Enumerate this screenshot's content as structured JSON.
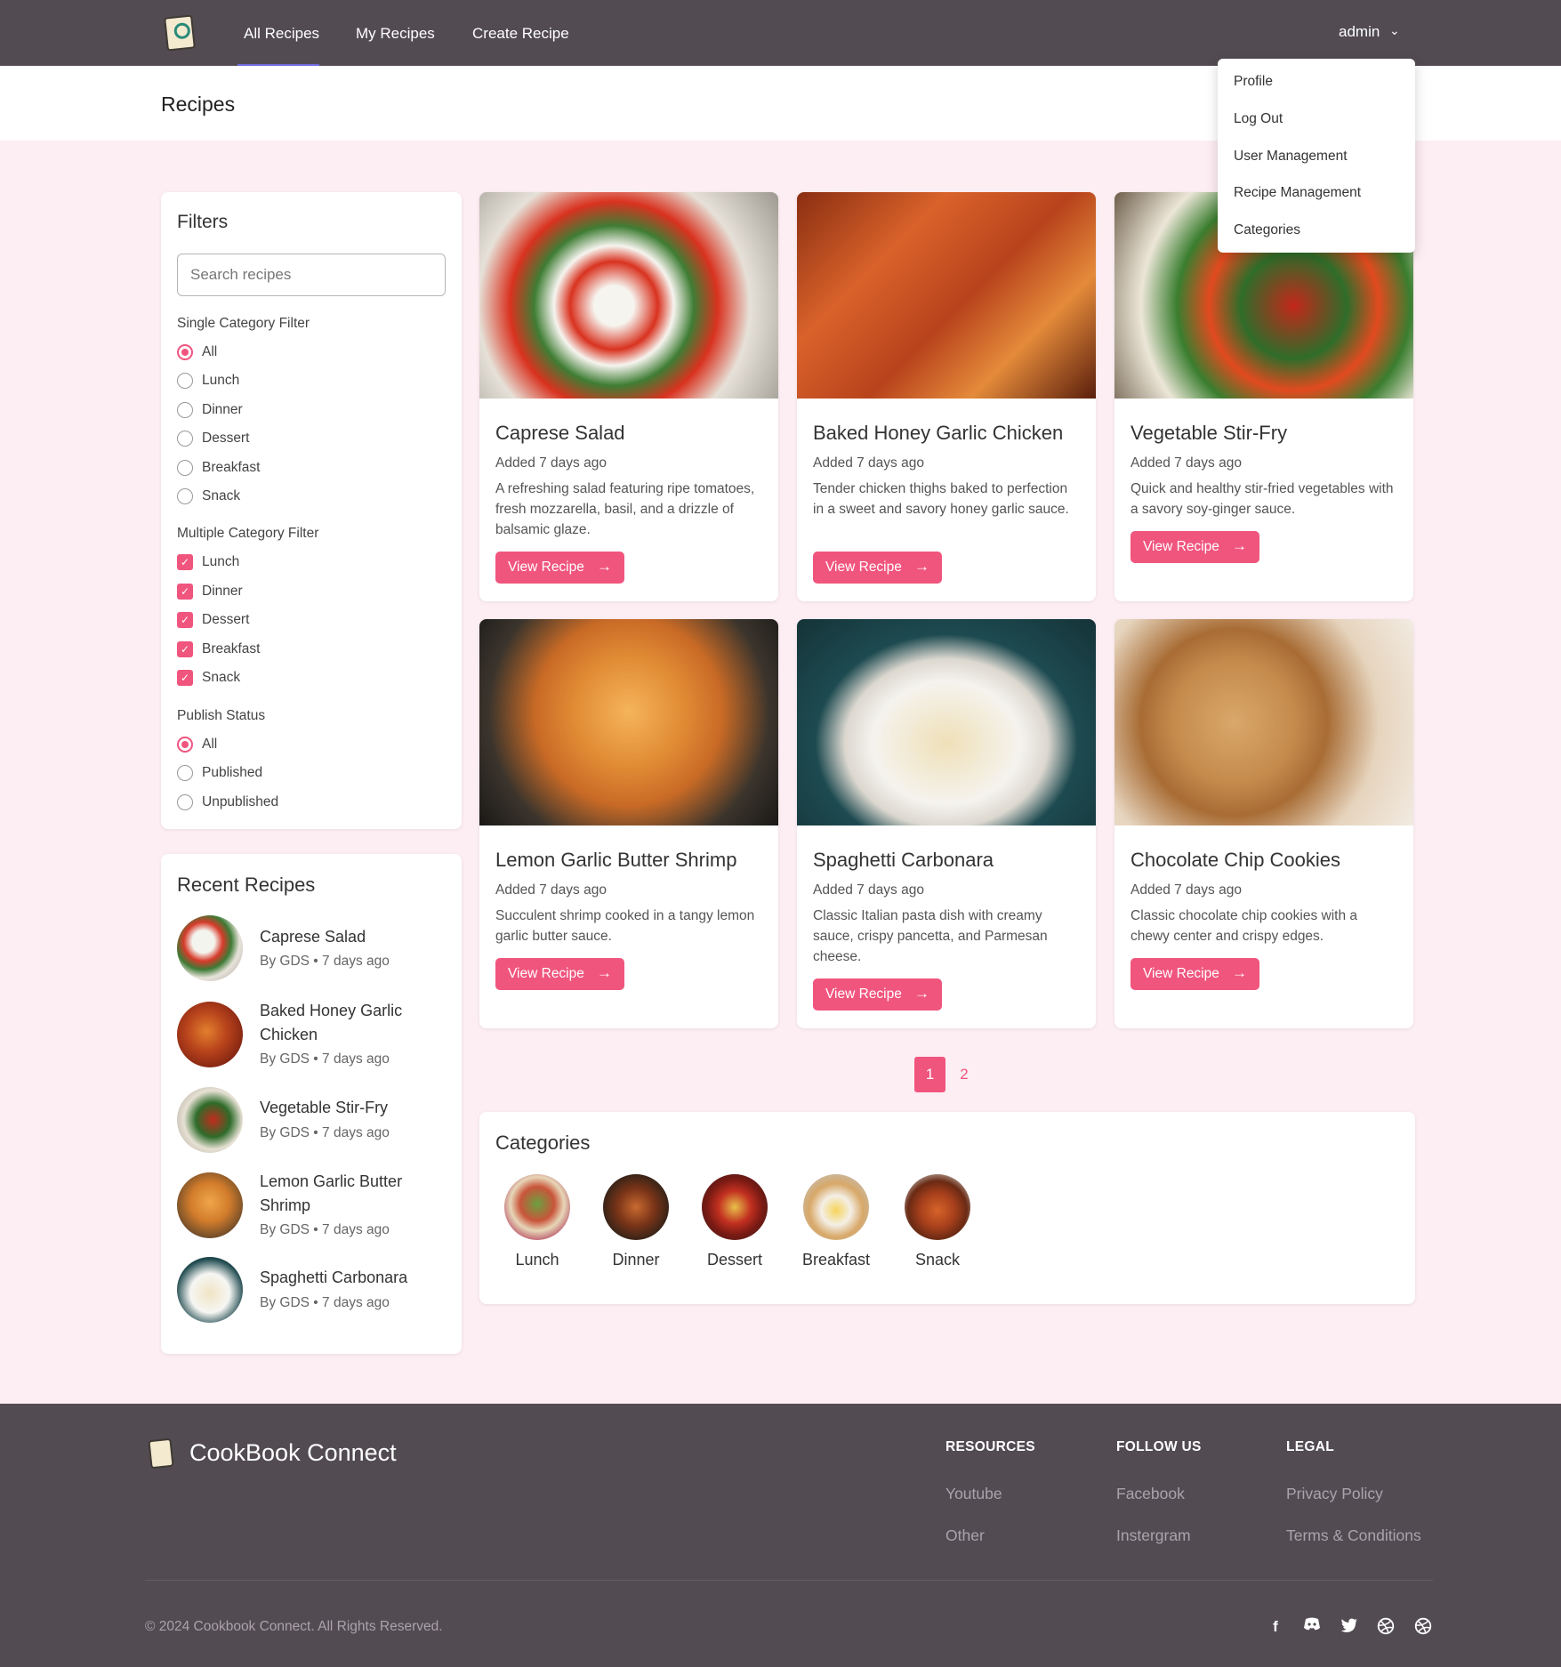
{
  "nav": {
    "links": [
      "All Recipes",
      "My Recipes",
      "Create Recipe"
    ],
    "user": "admin",
    "dropdown": [
      "Profile",
      "Log Out",
      "User Management",
      "Recipe Management",
      "Categories"
    ]
  },
  "page": {
    "title": "Recipes"
  },
  "filters": {
    "title": "Filters",
    "search_placeholder": "Search recipes",
    "single_title": "Single Category Filter",
    "single_options": [
      "All",
      "Lunch",
      "Dinner",
      "Dessert",
      "Breakfast",
      "Snack"
    ],
    "single_selected": "All",
    "multiple_title": "Multiple Category Filter",
    "multiple_options": [
      "Lunch",
      "Dinner",
      "Dessert",
      "Breakfast",
      "Snack"
    ],
    "publish_title": "Publish Status",
    "publish_options": [
      "All",
      "Published",
      "Unpublished"
    ],
    "publish_selected": "All"
  },
  "recent": {
    "title": "Recent Recipes",
    "items": [
      {
        "name": "Caprese Salad",
        "meta": "By GDS • 7 days ago"
      },
      {
        "name": "Baked Honey Garlic Chicken",
        "meta": "By GDS • 7 days ago"
      },
      {
        "name": "Vegetable Stir-Fry",
        "meta": "By GDS • 7 days ago"
      },
      {
        "name": "Lemon Garlic Butter Shrimp",
        "meta": "By GDS • 7 days ago"
      },
      {
        "name": "Spaghetti Carbonara",
        "meta": "By GDS • 7 days ago"
      }
    ]
  },
  "recipes": [
    {
      "title": "Caprese Salad",
      "date": "Added 7 days ago",
      "desc": "A refreshing salad featuring ripe tomatoes, fresh mozzarella, basil, and a drizzle of balsamic glaze.",
      "button": "View Recipe"
    },
    {
      "title": "Baked Honey Garlic Chicken",
      "date": "Added 7 days ago",
      "desc": "Tender chicken thighs baked to perfection in a sweet and savory honey garlic sauce.",
      "button": "View Recipe"
    },
    {
      "title": "Vegetable Stir-Fry",
      "date": "Added 7 days ago",
      "desc": "Quick and healthy stir-fried vegetables with a savory soy-ginger sauce.",
      "button": "View Recipe"
    },
    {
      "title": "Lemon Garlic Butter Shrimp",
      "date": "Added 7 days ago",
      "desc": "Succulent shrimp cooked in a tangy lemon garlic butter sauce.",
      "button": "View Recipe"
    },
    {
      "title": "Spaghetti Carbonara",
      "date": "Added 7 days ago",
      "desc": "Classic Italian pasta dish with creamy sauce, crispy pancetta, and Parmesan cheese.",
      "button": "View Recipe"
    },
    {
      "title": "Chocolate Chip Cookies",
      "date": "Added 7 days ago",
      "desc": "Classic chocolate chip cookies with a chewy center and crispy edges.",
      "button": "View Recipe"
    }
  ],
  "pagination": {
    "pages": [
      "1",
      "2"
    ],
    "current": "1"
  },
  "categories": {
    "title": "Categories",
    "items": [
      "Lunch",
      "Dinner",
      "Dessert",
      "Breakfast",
      "Snack"
    ]
  },
  "footer": {
    "brand": "CookBook Connect",
    "columns": [
      {
        "heading": "RESOURCES",
        "links": [
          "Youtube",
          "Other"
        ]
      },
      {
        "heading": "FOLLOW US",
        "links": [
          "Facebook",
          "Instergram"
        ]
      },
      {
        "heading": "LEGAL",
        "links": [
          "Privacy Policy",
          "Terms & Conditions"
        ]
      }
    ],
    "copyright": "© 2024 Cookbook Connect. All Rights Reserved.",
    "social_icons": [
      "facebook-icon",
      "discord-icon",
      "twitter-icon",
      "dribbble-icon",
      "dribbble-icon"
    ]
  },
  "colors": {
    "accent": "#f0557e",
    "nav_bg": "#524b52",
    "page_bg": "#fdeef3"
  }
}
